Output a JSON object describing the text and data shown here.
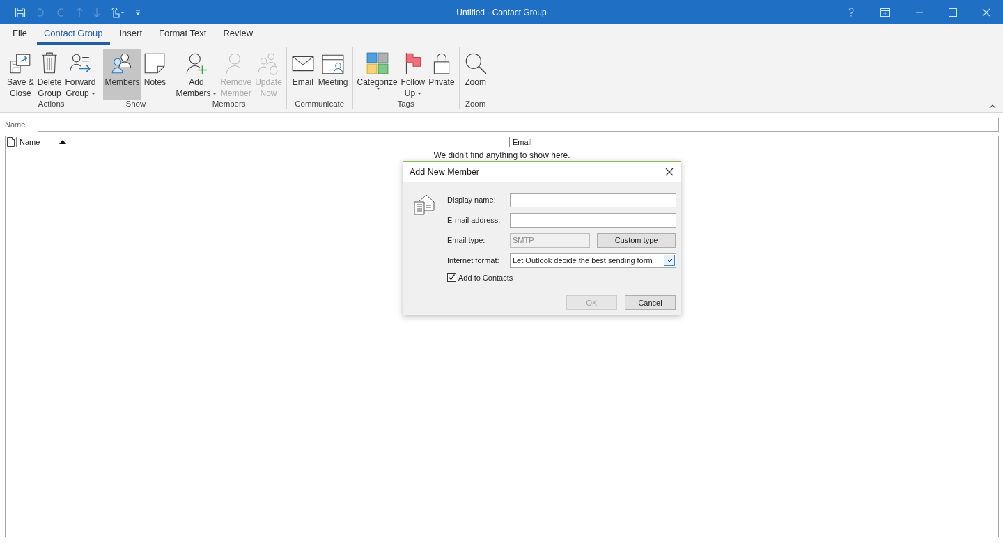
{
  "window": {
    "title": "Untitled  -  Contact Group"
  },
  "tabs": [
    {
      "label": "File",
      "selected": false
    },
    {
      "label": "Contact Group",
      "selected": true
    },
    {
      "label": "Insert",
      "selected": false
    },
    {
      "label": "Format Text",
      "selected": false
    },
    {
      "label": "Review",
      "selected": false
    }
  ],
  "ribbon": {
    "groups": [
      {
        "label": "Actions",
        "buttons": [
          {
            "kind": "save",
            "lines": [
              "Save &",
              "Close"
            ],
            "dropdown": false,
            "disabled": false,
            "selected": false
          },
          {
            "kind": "delete",
            "lines": [
              "Delete",
              "Group"
            ],
            "dropdown": false,
            "disabled": false,
            "selected": false
          },
          {
            "kind": "forward",
            "lines": [
              "Forward",
              "Group"
            ],
            "dropdown": true,
            "disabled": false,
            "selected": false
          }
        ]
      },
      {
        "label": "Show",
        "buttons": [
          {
            "kind": "members",
            "lines": [
              "Members"
            ],
            "dropdown": false,
            "disabled": false,
            "selected": true
          },
          {
            "kind": "notes",
            "lines": [
              "Notes"
            ],
            "dropdown": false,
            "disabled": false,
            "selected": false
          }
        ]
      },
      {
        "label": "Members",
        "buttons": [
          {
            "kind": "add",
            "lines": [
              "Add",
              "Members"
            ],
            "dropdown": true,
            "disabled": false,
            "selected": false
          },
          {
            "kind": "remove",
            "lines": [
              "Remove",
              "Member"
            ],
            "dropdown": false,
            "disabled": true,
            "selected": false
          },
          {
            "kind": "update",
            "lines": [
              "Update",
              "Now"
            ],
            "dropdown": false,
            "disabled": true,
            "selected": false
          }
        ]
      },
      {
        "label": "Communicate",
        "buttons": [
          {
            "kind": "email",
            "lines": [
              "Email"
            ],
            "dropdown": false,
            "disabled": false,
            "selected": false
          },
          {
            "kind": "meeting",
            "lines": [
              "Meeting"
            ],
            "dropdown": false,
            "disabled": false,
            "selected": false
          }
        ]
      },
      {
        "label": "Tags",
        "buttons": [
          {
            "kind": "categorize",
            "lines": [
              "Categorize"
            ],
            "dropdown": true,
            "disabled": false,
            "selected": false
          },
          {
            "kind": "followup",
            "lines": [
              "Follow",
              "Up"
            ],
            "dropdown": true,
            "disabled": false,
            "selected": false
          },
          {
            "kind": "private",
            "lines": [
              "Private"
            ],
            "dropdown": false,
            "disabled": false,
            "selected": false
          }
        ]
      },
      {
        "label": "Zoom",
        "buttons": [
          {
            "kind": "zoom",
            "lines": [
              "Zoom"
            ],
            "dropdown": false,
            "disabled": false,
            "selected": false
          }
        ]
      }
    ]
  },
  "name_field": {
    "label": "Name"
  },
  "table": {
    "columns": [
      {
        "label": "Name",
        "sorted": true
      },
      {
        "label": "Email",
        "sorted": false
      }
    ],
    "empty_message": "We didn't find anything to show here."
  },
  "dialog": {
    "title": "Add New Member",
    "display_name": {
      "label": "Display name:"
    },
    "email_address": {
      "label": "E-mail address:"
    },
    "email_type": {
      "label": "Email type:",
      "value": "SMTP",
      "button": "Custom type"
    },
    "internet_format": {
      "label": "Internet format:",
      "value": "Let Outlook decide the best sending form"
    },
    "add_to_contacts": {
      "label": "Add to Contacts",
      "checked": true
    },
    "buttons": [
      {
        "label": "OK",
        "disabled": true
      },
      {
        "label": "Cancel",
        "disabled": false
      }
    ]
  }
}
